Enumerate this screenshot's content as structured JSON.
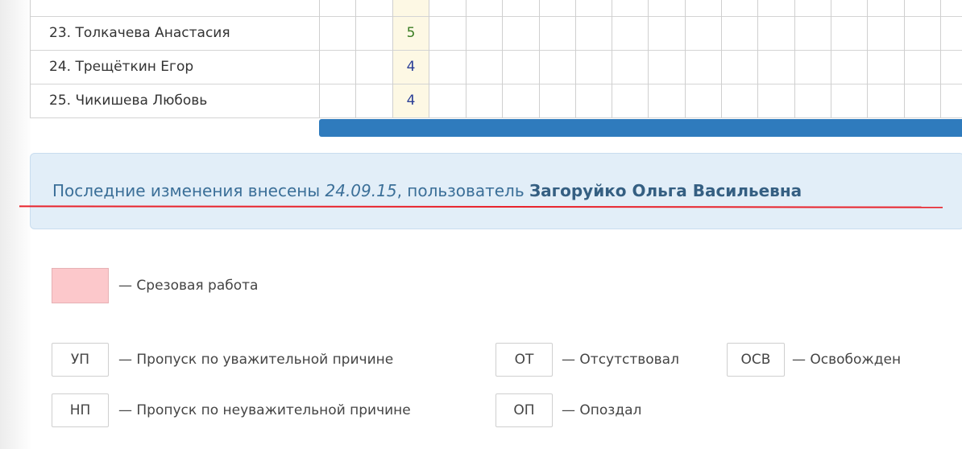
{
  "journal": {
    "rows": [
      {
        "name": "23. Толкачева Анастасия",
        "mark": "5"
      },
      {
        "name": "24. Трещёткин Егор",
        "mark": "4"
      },
      {
        "name": "25. Чикишева Любовь",
        "mark": "4"
      }
    ]
  },
  "info": {
    "prefix": "Последние изменения внесены ",
    "date": "24.09.15",
    "middle": ", пользователь ",
    "user": "Загоруйко Ольга Васильевна"
  },
  "legend": {
    "control_work": "— Срезовая работа",
    "codes": [
      {
        "code": "УП",
        "text": "— Пропуск по уважительной причине"
      },
      {
        "code": "ОТ",
        "text": "— Отсутствовал"
      },
      {
        "code": "ОСВ",
        "text": "— Освобожден"
      },
      {
        "code": "НП",
        "text": "— Пропуск по неуважительной причине"
      },
      {
        "code": "ОП",
        "text": "— Опоздал"
      }
    ]
  },
  "colors": {
    "scrollbar": "#2f7bbd",
    "info_bg": "#e2eef8",
    "control_work_swatch": "#fcc8cb",
    "underline": "#e8232c"
  }
}
